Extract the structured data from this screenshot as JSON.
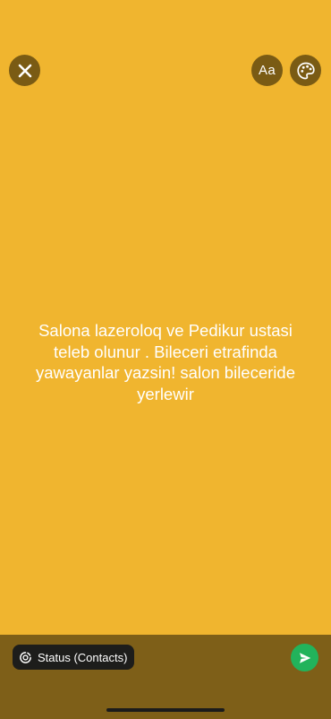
{
  "colors": {
    "canvas_background": "#f0b52f",
    "bottom_bar_background": "#7e5f18",
    "toolbar_button_background": "#7a5b14",
    "send_button": "#22b35b",
    "audience_pill_background": "#1d1d1b",
    "text": "#ffffff"
  },
  "toolbar": {
    "close_icon": "close-icon",
    "font_button_label": "Aa",
    "palette_icon": "palette-icon"
  },
  "status": {
    "text": "Salona lazeroloq ve Pedikur ustasi\nteleb olunur . Bileceri etrafinda\nyawayanlar yazsin! salon bileceride\nyerlewir"
  },
  "footer": {
    "audience_icon": "status-ring-icon",
    "audience_label": "Status (Contacts)",
    "send_icon": "send-icon"
  }
}
